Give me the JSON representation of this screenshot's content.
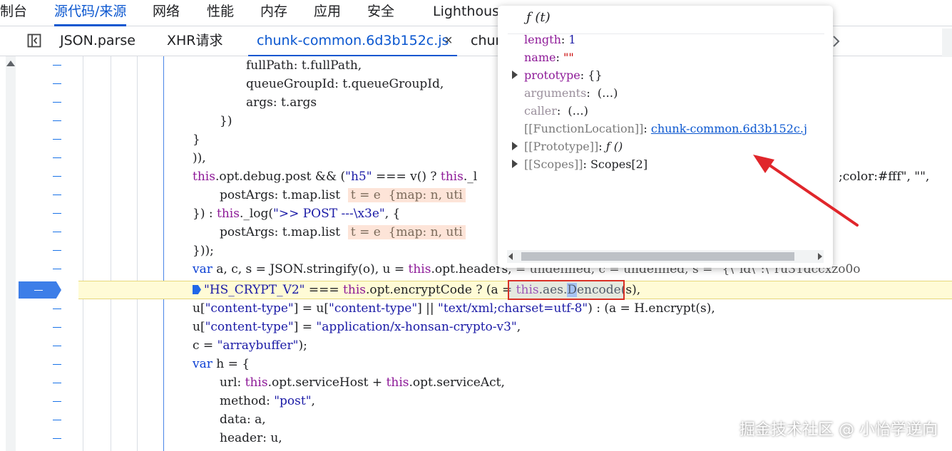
{
  "top_tabs": [
    "制台",
    "源代码/来源",
    "网络",
    "性能",
    "内存",
    "应用",
    "安全",
    "Lighthouse"
  ],
  "file_tabs": {
    "items": [
      "JSON.parse",
      "XHR请求",
      "chunk-common.6d3b152c.js",
      "chun"
    ],
    "close_glyph": "×"
  },
  "code": {
    "l1": "fullPath: t.fullPath,",
    "l2": "queueGroupId: t.queueGroupId,",
    "l3": "args: t.args",
    "l4": "})",
    "l5": "}",
    "l6": ")),",
    "l7a": "this",
    "l7b": ".opt.debug.post && (",
    "l7c": "\"h5\"",
    "l7d": " === v() ? ",
    "l7e": "this",
    "l7f": "._l",
    "l7g": ";color:#fff\", \"\",",
    "l8a": "postArgs: t.map.list",
    "l8b": "t = e  {map: n, uti",
    "l9a": "}) : ",
    "l9b": "this",
    "l9c": "._log(",
    "l9d": "\">> POST ---\\x3e\"",
    "l9e": ", {",
    "l10a": "postArgs: t.map.list",
    "l10b": "t = e  {map: n, uti",
    "l11": "}));",
    "l12a": "var",
    "l12b": " a, c, s = JSON.stringify(o), u = ",
    "l12c": "this",
    "l12d": ".opt.headers,",
    "l12e": " = undefined, c = undefined, s = \"{\\\"id\\\":\\\"ru31dccxzo0o",
    "l13a": "\"HS_CRYPT_V2\"",
    "l13b": " === ",
    "l13c": "this",
    "l13d": ".opt.encryptCode ? (a = ",
    "l13e": "this",
    "l13f": ".aes.",
    "l13g": "D",
    "l13h": "encode",
    "l13i": "(s),",
    "l14a": "u[",
    "l14b": "\"content-type\"",
    "l14c": "] = u[",
    "l14d": "\"content-type\"",
    "l14e": "] || ",
    "l14f": "\"text/xml;charset=utf-8\"",
    "l14g": ") : (a = H.encrypt(s),",
    "l15a": "u[",
    "l15b": "\"content-type\"",
    "l15c": "] = ",
    "l15d": "\"application/x-honsan-crypto-v3\"",
    "l15e": ",",
    "l16a": "c = ",
    "l16b": "\"arraybuffer\"",
    "l16c": ");",
    "l17a": "var",
    "l17b": " h = {",
    "l18a": "url: ",
    "l18b": "this",
    "l18c": ".opt.serviceHost + ",
    "l18d": "this",
    "l18e": ".opt.serviceAct,",
    "l19a": "method: ",
    "l19b": "\"post\"",
    "l19c": ",",
    "l20": "data: a,",
    "l21": "header: u,"
  },
  "popover": {
    "title": "ƒ (t)",
    "props": {
      "length_key": "length",
      "length_val": "1",
      "name_key": "name",
      "name_val": "\"\"",
      "prototype_key": "prototype",
      "prototype_val": "{}",
      "arguments_key": "arguments",
      "arguments_val": "(…)",
      "caller_key": "caller",
      "caller_val": "(…)",
      "location_key": "[[FunctionLocation]]",
      "location_val": "chunk-common.6d3b152c.j",
      "proto_key": "[[Prototype]]",
      "proto_val": "ƒ ()",
      "scopes_key": "[[Scopes]]",
      "scopes_val": "Scopes[2]"
    }
  },
  "watermark": "掘金技术社区 @ 小怡学逆向",
  "colors": {
    "accent": "#0b57d0",
    "highlight_line": "#fffbd6",
    "breakpoint": "#3d7ee8",
    "annotation_red": "#d93025"
  }
}
